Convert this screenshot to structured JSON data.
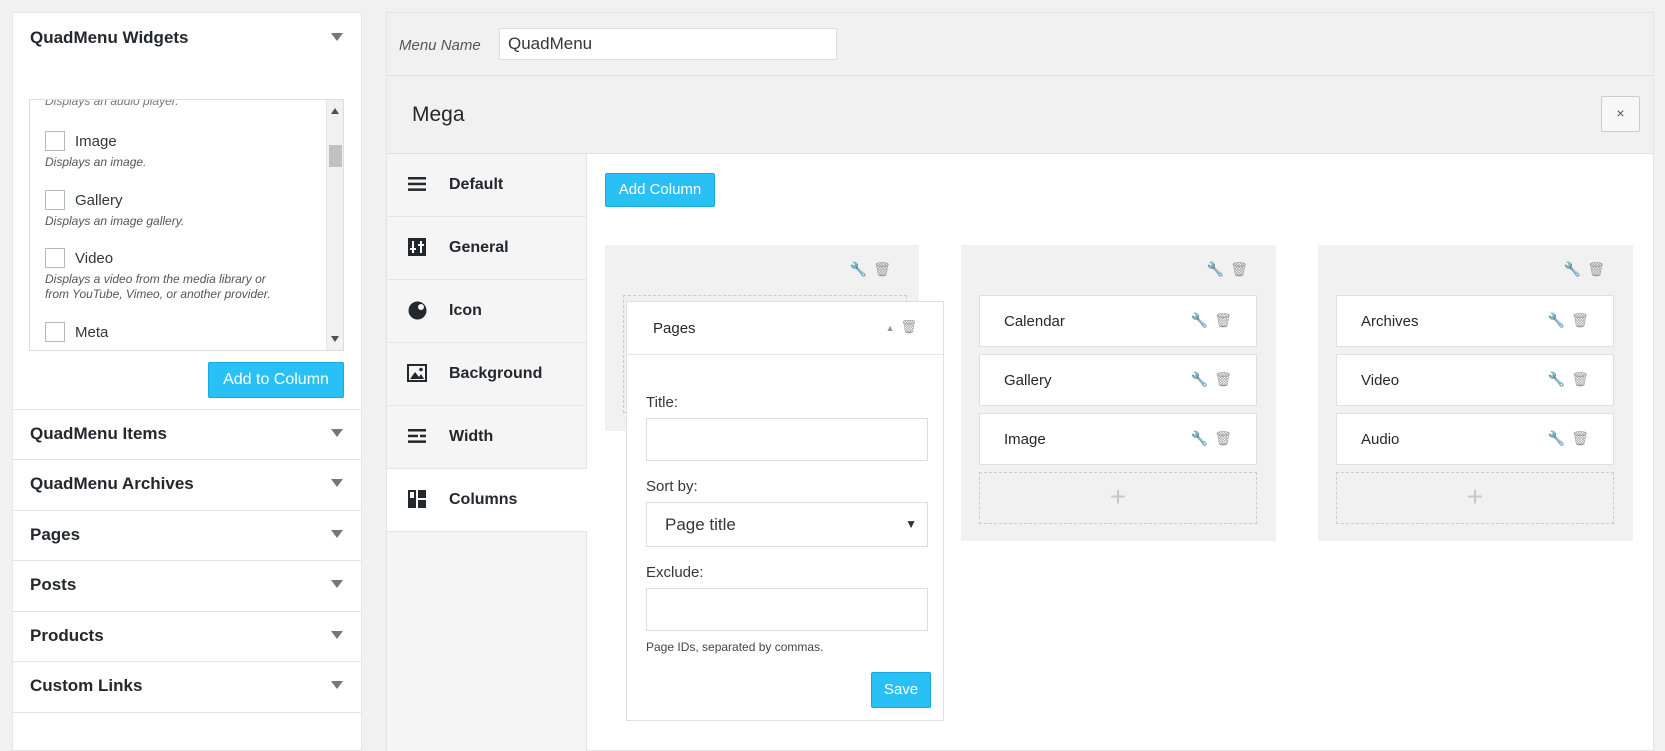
{
  "sidebar": {
    "widgets_title": "QuadMenu Widgets",
    "widgets_clipped_desc": "Displays an audio player.",
    "widgets": [
      {
        "label": "Image",
        "desc": [
          "Displays an image."
        ]
      },
      {
        "label": "Gallery",
        "desc": [
          "Displays an image gallery."
        ]
      },
      {
        "label": "Video",
        "desc": [
          "Displays a video from the media library or",
          "from YouTube, Vimeo, or another provider."
        ]
      },
      {
        "label": "Meta",
        "desc": []
      }
    ],
    "add_to_column": "Add to Column",
    "sections": [
      "QuadMenu Items",
      "QuadMenu Archives",
      "Pages",
      "Posts",
      "Products",
      "Custom Links"
    ]
  },
  "main": {
    "menu_name_label": "Menu Name",
    "menu_name_value": "QuadMenu",
    "mega_title": "Mega",
    "close_label": "×",
    "tabs": [
      "Default",
      "General",
      "Icon",
      "Background",
      "Width",
      "Columns"
    ],
    "add_column": "Add Column",
    "columns": [
      {
        "items": []
      },
      {
        "items": [
          "Calendar",
          "Gallery",
          "Image"
        ]
      },
      {
        "items": [
          "Archives",
          "Video",
          "Audio"
        ]
      }
    ],
    "add_slot_label": "+",
    "form": {
      "title": "Pages",
      "title_label": "Title:",
      "sort_label": "Sort by:",
      "sort_value": "Page title",
      "exclude_label": "Exclude:",
      "help": "Page IDs, separated by commas.",
      "save": "Save"
    }
  },
  "colors": {
    "accent": "#29c0f6",
    "panel_bg": "#f1f1f1"
  }
}
